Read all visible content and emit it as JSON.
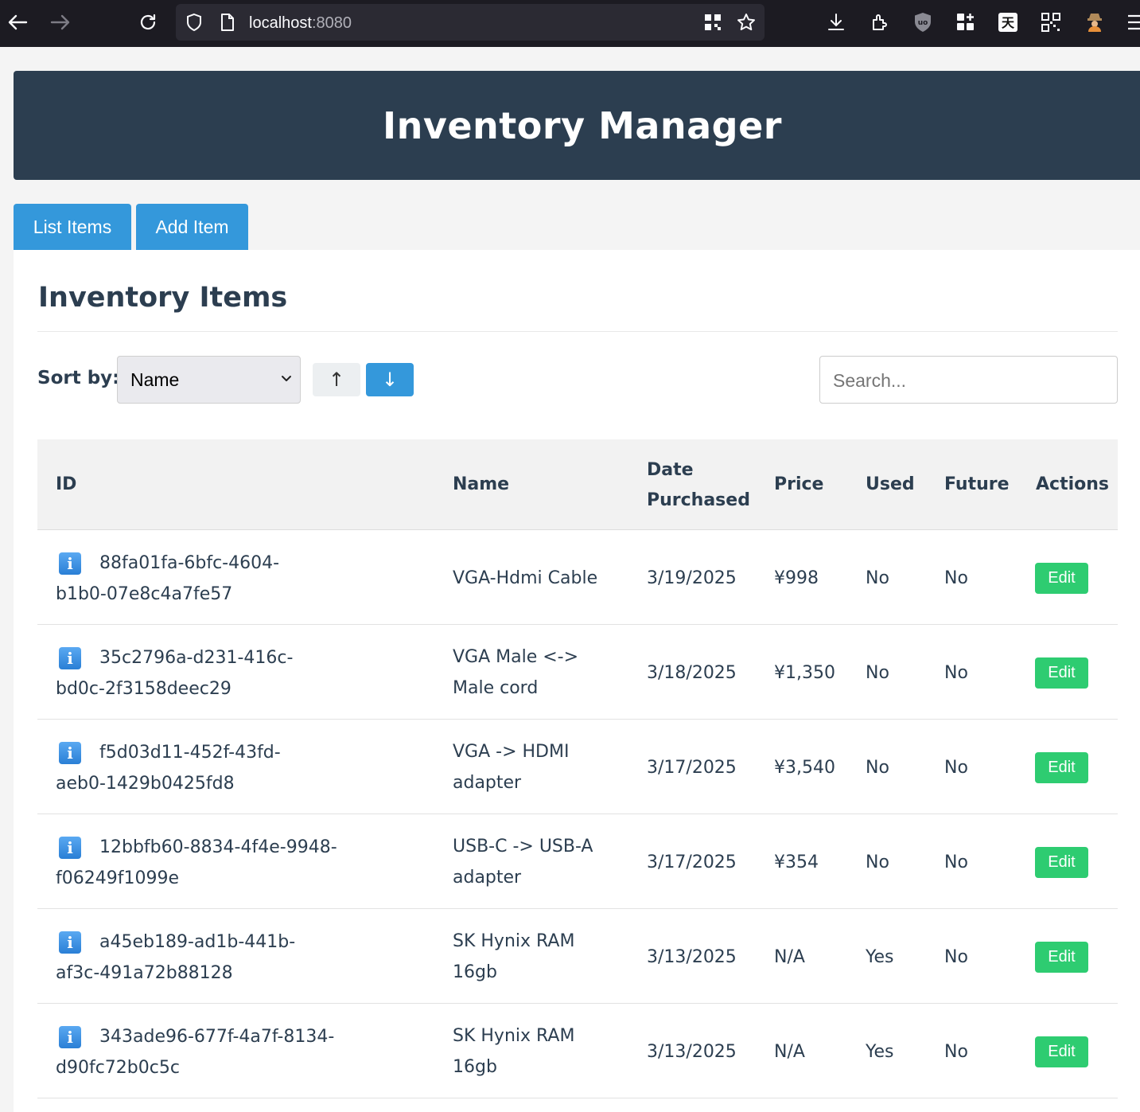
{
  "browser": {
    "url_host": "localhost",
    "url_port": ":8080"
  },
  "header": {
    "title": "Inventory Manager"
  },
  "tabs": [
    {
      "label": "List Items"
    },
    {
      "label": "Add Item"
    }
  ],
  "main": {
    "title": "Inventory Items",
    "sort_label": "Sort by:",
    "sort_value": "Name",
    "asc_symbol": "↑",
    "desc_symbol": "↓",
    "search_placeholder": "Search..."
  },
  "table": {
    "columns": {
      "id": "ID",
      "name": "Name",
      "date_line1": "Date",
      "date_line2": "Purchased",
      "price": "Price",
      "used": "Used",
      "future": "Future",
      "actions": "Actions"
    },
    "edit_label": "Edit",
    "info_glyph": "i",
    "rows": [
      {
        "id1": "88fa01fa-6bfc-4604-",
        "id2": "b1b0-07e8c4a7fe57",
        "name1": "VGA-Hdmi Cable",
        "name2": "",
        "date": "3/19/2025",
        "price": "¥998",
        "used": "No",
        "future": "No"
      },
      {
        "id1": "35c2796a-d231-416c-",
        "id2": "bd0c-2f3158deec29",
        "name1": "VGA Male <->",
        "name2": "Male cord",
        "date": "3/18/2025",
        "price": "¥1,350",
        "used": "No",
        "future": "No"
      },
      {
        "id1": "f5d03d11-452f-43fd-",
        "id2": "aeb0-1429b0425fd8",
        "name1": "VGA -> HDMI",
        "name2": "adapter",
        "date": "3/17/2025",
        "price": "¥3,540",
        "used": "No",
        "future": "No"
      },
      {
        "id1": "12bbfb60-8834-4f4e-9948-",
        "id2": "f06249f1099e",
        "name1": "USB-C -> USB-A",
        "name2": "adapter",
        "date": "3/17/2025",
        "price": "¥354",
        "used": "No",
        "future": "No"
      },
      {
        "id1": "a45eb189-ad1b-441b-",
        "id2": "af3c-491a72b88128",
        "name1": "SK Hynix RAM",
        "name2": "16gb",
        "date": "3/13/2025",
        "price": "N/A",
        "used": "Yes",
        "future": "No"
      },
      {
        "id1": "343ade96-677f-4a7f-8134-",
        "id2": "d90fc72b0c5c",
        "name1": "SK Hynix RAM",
        "name2": "16gb",
        "date": "3/13/2025",
        "price": "N/A",
        "used": "Yes",
        "future": "No"
      }
    ]
  },
  "colors": {
    "header_bg": "#2c3e50",
    "accent": "#3498db",
    "edit": "#2ecc71"
  }
}
